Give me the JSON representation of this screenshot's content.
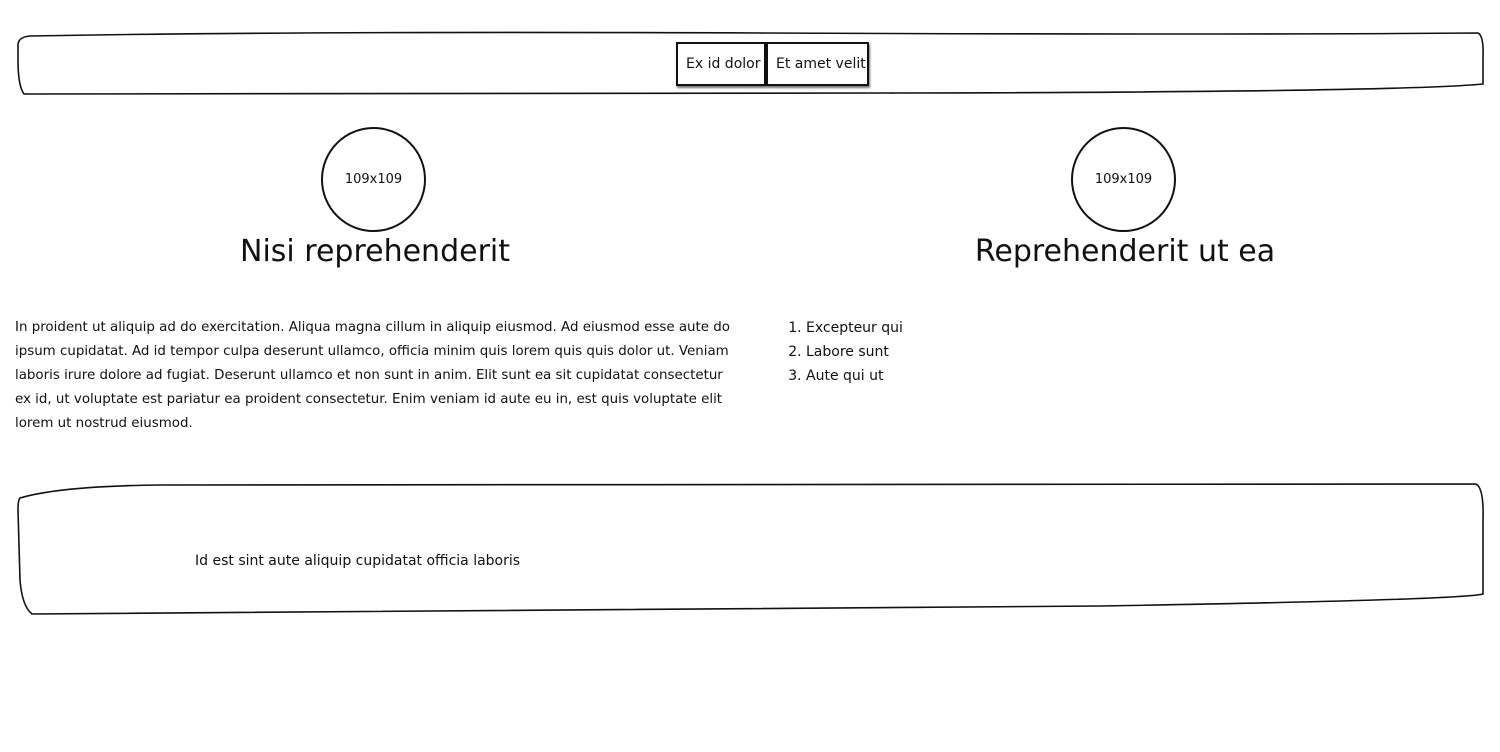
{
  "nav": {
    "items": [
      {
        "label": "Ex id dolor"
      },
      {
        "label": "Et amet velit"
      }
    ]
  },
  "left": {
    "image_placeholder": "109x109",
    "heading": "Nisi reprehenderit",
    "paragraph": "In proident ut aliquip ad do exercitation. Aliqua magna cillum in aliquip eiusmod. Ad eiusmod esse aute do ipsum cupidatat. Ad id tempor culpa deserunt ullamco, officia minim quis lorem quis quis dolor ut. Veniam laboris irure dolore ad fugiat. Deserunt ullamco et non sunt in anim. Elit sunt ea sit cupidatat consectetur ex id, ut voluptate est pariatur ea proident consectetur. Enim veniam id aute eu in, est quis voluptate elit lorem ut nostrud eiusmod."
  },
  "right": {
    "image_placeholder": "109x109",
    "heading": "Reprehenderit ut ea",
    "list": [
      "Excepteur qui",
      "Labore sunt",
      "Aute qui ut"
    ]
  },
  "footer": {
    "text": "Id est sint aute aliquip cupidatat officia laboris"
  }
}
